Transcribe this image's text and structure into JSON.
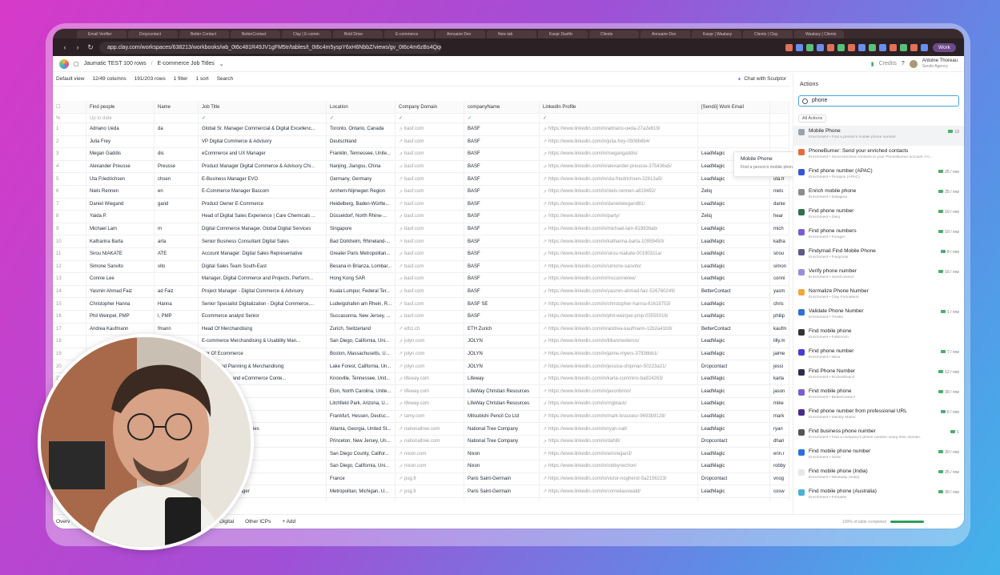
{
  "browser": {
    "url": "app.clay.com/workspaces/638213/workbooks/wb_0t6c481R49JV1gFM5tr/tables/t_0t6c4m5yspY6xH6NbbZ/views/gv_0t6c4m6zBs4Qq6w6z3y",
    "profile_label": "Work",
    "tabs": [
      "Email Verifier",
      "Dropcontact",
      "Better Contact",
      "BetterContact",
      "Clay | E-comm",
      "Bold Drive",
      "E-commerce",
      "Annuaire Dev",
      "New tab",
      "Kaspr Dashb",
      "Clients",
      "Annuaire Dev",
      "Kaspr | Waalaxy",
      "Clients | Clay",
      "Waalaxy | Clients"
    ]
  },
  "app": {
    "workspace": "Jaumatic TEST 100 rows",
    "view": "E-commerce Job Titles",
    "credits": "Credits",
    "user_name": "Antoine Thoreau",
    "user_org": "Sendo Agency"
  },
  "toolbar": {
    "view_btn": "Default view",
    "columns": "12/49 columns",
    "rows": "191/203 rows",
    "filter": "1 filter",
    "sort": "1 sort",
    "search": "Search",
    "chat": "Chat with Sculptor"
  },
  "columns": [
    "Find people",
    "Name",
    "Job Title",
    "Location",
    "Company Domain",
    "companyName",
    "LinkedIn Profile",
    "[Sendō] Work Email",
    ""
  ],
  "status_row": {
    "find": "Up to date",
    "check": "✓"
  },
  "rows": [
    [
      "1",
      "Adriano Ueda",
      "da",
      "Global Sr. Manager Commercial & Digital Excellenc...",
      "Toronto, Ontario, Canada",
      "basf.com",
      "BASF",
      "https://www.linkedin.com/in/adriano-ueda-27a2e619/",
      "",
      ""
    ],
    [
      "2",
      "Julia Frey",
      "",
      "VP Digital Commerce & Advisory",
      "Deutschland",
      "basf.com",
      "BASF",
      "https://www.linkedin.com/in/julia-frey-0506b8b4/",
      "",
      ""
    ],
    [
      "3",
      "Megan Gaddis",
      "dis",
      "eCommerce and UX Manager",
      "Franklin, Tennessee, Unite...",
      "basf.com",
      "BASF",
      "https://www.linkedin.com/in/megangaddis/",
      "LeadMagic",
      "mega"
    ],
    [
      "4",
      "Alexander Preusse",
      "Preusse",
      "Product Manager Digital Commerce & Advisory Chi...",
      "Nanjing, Jiangsu, China",
      "basf.com",
      "BASF",
      "https://www.linkedin.com/in/alexander-preusse-375436a5/",
      "LeadMagic",
      "alexa"
    ],
    [
      "5",
      "Uta Friedrichsen",
      "chsen",
      "E-Business Manager EVO",
      "Germany, Germany",
      "basf.com",
      "BASF",
      "https://www.linkedin.com/in/uta-friedrichsen-22813a5/",
      "LeadMagic",
      "uta.fr"
    ],
    [
      "6",
      "Niels Rennen",
      "en",
      "E-Commerce Manager Bascom",
      "Arnhem-Nijmegen Region",
      "basf.com",
      "BASF",
      "https://www.linkedin.com/in/niels-rennen-a819492/",
      "Zeliq",
      "niels"
    ],
    [
      "7",
      "Daniel Wiegand",
      "gand",
      "Product Owner E-Commerce",
      "Heidelberg, Baden-Württe...",
      "basf.com",
      "BASF",
      "https://www.linkedin.com/in/danielwiegand81/",
      "LeadMagic",
      "danie"
    ],
    [
      "8",
      "Yaida P.",
      "",
      "Head of Digital Sales Experience | Care Chemicals ...",
      "Düsseldorf, North Rhine-...",
      "basf.com",
      "BASF",
      "https://www.linkedin.com/in/party/",
      "Zeliq",
      "hear"
    ],
    [
      "9",
      "Michael Lam",
      "m",
      "Digital Commerce Manager, Global Digital Services",
      "Singapore",
      "basf.com",
      "BASF",
      "https://www.linkedin.com/in/michael-lam-819836ab/",
      "LeadMagic",
      "mich"
    ],
    [
      "10",
      "Katharina Barta",
      "arta",
      "Senior Business Consultant Digital Sales",
      "Bad Dürkheim, Rhineland-...",
      "basf.com",
      "BASF",
      "https://www.linkedin.com/in/katharina-barta-10959450/",
      "LeadMagic",
      "katha"
    ],
    [
      "11",
      "Sirou NIAKATE",
      "ATE",
      "Account Manager: Digital Sales Representative",
      "Greater Paris Metropolitan...",
      "basf.com",
      "BASF",
      "https://www.linkedin.com/in/sirou-niakate-00190311a/",
      "LeadMagic",
      "sirou"
    ],
    [
      "12",
      "Simone Sanvito",
      "vito",
      "Digital Sales Team South-East",
      "Besana in Brianza, Lombar...",
      "basf.com",
      "BASF",
      "https://www.linkedin.com/in/simone-sanvito/",
      "LeadMagic",
      "simon"
    ],
    [
      "13",
      "Connie Lee",
      "",
      "Manager, Digital Commerce and Projects, Perform...",
      "Hong Kong SAR",
      "basf.com",
      "BASF",
      "https://www.linkedin.com/in/msconnielee/",
      "LeadMagic",
      "conni"
    ],
    [
      "14",
      "Yasmin Ahmad Faiz",
      "ad Faiz",
      "Project Manager - Digital Commerce & Advisory",
      "Kuala Lumpur, Federal Ter...",
      "basf.com",
      "BASF",
      "https://www.linkedin.com/in/yasmin-ahmad-faiz-526760249/",
      "BetterContact",
      "yasm"
    ],
    [
      "15",
      "Christopher Hanna",
      "Hanna",
      "Senior Specialist Digitalization - Digital Commerce,...",
      "Ludwigshafen am Rhein, R...",
      "basf.com",
      "BASF SE",
      "https://www.linkedin.com/in/christopher-hanna-81618753/",
      "LeadMagic",
      "chris"
    ],
    [
      "16",
      "Phil Weinpel, PMP",
      "l, PMP",
      "Ecommerce analyst Senior",
      "Succasunna, New Jersey, ...",
      "basf.com",
      "BASF",
      "https://www.linkedin.com/in/phil-weinpel-pmp-03555016/",
      "LeadMagic",
      "philip"
    ],
    [
      "17",
      "Andrea Kaufmann",
      "fmann",
      "Head Of Merchandising",
      "Zurich, Switzerland",
      "ethz.ch",
      "ETH Zurich",
      "https://www.linkedin.com/in/andrea-kaufmann-12b2a41b9/",
      "BetterContact",
      "kaufm"
    ],
    [
      "18",
      "",
      "",
      "E-commerce Merchandising & Usability Man...",
      "San Diego, California, Uni...",
      "jolyn.com",
      "JOLYN",
      "https://www.linkedin.com/in/lillianmedeiros/",
      "LeadMagic",
      "lilly.m"
    ],
    [
      "19",
      "",
      "",
      "ctor Of Ecommerce",
      "Boston, Massachusetts, U...",
      "jolyn.com",
      "JOLYN",
      "https://www.linkedin.com/in/jaime-myers-37936bb1/",
      "LeadMagic",
      "jaime"
    ],
    [
      "20",
      "",
      "",
      "or, Demand Planning & Merchandising",
      "Lake Forest, California, Un...",
      "jolyn.com",
      "JOLYN",
      "https://www.linkedin.com/in/jessica-shipman-50223a21/",
      "Dropcontact",
      "jessi"
    ],
    [
      "21",
      "",
      "",
      "ting Strategist and eCommerce Conte...",
      "Knoxville, Tennessee, Unit...",
      "lifeway.com",
      "Lifeway",
      "https://www.linkedin.com/in/karla-cummins-ba924263/",
      "LeadMagic",
      "karla"
    ],
    [
      "22",
      "",
      "",
      "& eCommerce",
      "Elon, North Carolina, Unite...",
      "lifeway.com",
      "LifeWay Christian Resources",
      "https://www.linkedin.com/in/jasonbrinn/",
      "LeadMagic",
      "jason"
    ],
    [
      "23",
      "",
      "",
      "ating & E-Commerce",
      "Litchfield Park, Arizona, U...",
      "lifeway.com",
      "LifeWay Christian Resources",
      "https://www.linkedin.com/in/mgblack/",
      "LeadMagic",
      "mike"
    ],
    [
      "24",
      "",
      "",
      "",
      "Frankfurt, Hessen, Deutsc...",
      "lamy.com",
      "Mitsubishi Pencil Co Ltd",
      "https://www.linkedin.com/in/mark-brasseur-9693b9128/",
      "LeadMagic",
      "mark"
    ],
    [
      "25",
      "",
      "",
      "merce Sales & Capabilities",
      "Atlanta, Georgia, United St...",
      "nationaltree.com",
      "National Tree Company",
      "https://www.linkedin.com/in/ryan-nall/",
      "LeadMagic",
      "ryan"
    ],
    [
      "26",
      "",
      "",
      "t",
      "Princeton, New Jersey, Un...",
      "nationaltree.com",
      "National Tree Company",
      "https://www.linkedin.com/in/dahill/",
      "Dropcontact",
      "dhari"
    ],
    [
      "27",
      "",
      "",
      "ger",
      "San Diego County, Califor...",
      "nixon.com",
      "Nixon",
      "https://www.linkedin.com/in/erinregan3/",
      "LeadMagic",
      "erin.r"
    ],
    [
      "28",
      "",
      "",
      "ger",
      "San Diego, California, Uni...",
      "nixon.com",
      "Nixon",
      "https://www.linkedin.com/in/robbynechon/",
      "LeadMagic",
      "robby"
    ],
    [
      "29",
      "",
      "",
      "rce project manager",
      "France",
      "psg.fr",
      "Paris Saint-Germain",
      "https://www.linkedin.com/in/victor-nogherot-5a2156223/",
      "Dropcontact",
      "vnog"
    ],
    [
      "30",
      "",
      "",
      "ce & Product Manager",
      "Metropolitan, Michigan, U...",
      "psg.fr",
      "Paris Saint-Germain",
      "https://www.linkedin.com/in/corneliaoswald/",
      "LeadMagic",
      "cosw"
    ],
    [
      "31",
      "",
      "",
      "Ecommerce",
      "Greater Paris Metropolitan...",
      "psg.fr",
      "Paris Saint-Germain",
      "https://www.linkedin.com/in/aaliamani/",
      "LeadMagic",
      "aalia"
    ]
  ],
  "tooltip": {
    "title": "Mobile Phone",
    "desc": "Find a person's mobile phone number."
  },
  "actions_panel": {
    "title": "Actions",
    "search_value": "phone",
    "filter": "All Actions",
    "items": [
      {
        "title": "Mobile Phone",
        "sub": "Enrichment • Find a person's mobile phone number.",
        "cost": "13",
        "color": "#9aa3ad"
      },
      {
        "title": "PhoneBurner: Send your enriched contacts",
        "sub": "Enrichment • Send enriched contacts to your PhoneBurner account. Fo...",
        "cost": "",
        "color": "#e86a3c"
      },
      {
        "title": "Find phone number (APAC)",
        "sub": "Enrichment • Prospeo (APAC)",
        "cost": "25 / row",
        "color": "#3557d6"
      },
      {
        "title": "Enrich mobile phone",
        "sub": "Enrichment • Datagma",
        "cost": "25 / row",
        "color": "#8c8c8c"
      },
      {
        "title": "Find phone number",
        "sub": "Enrichment • Zeliq",
        "cost": "10 / row",
        "color": "#2f6f4e"
      },
      {
        "title": "Find phone numbers",
        "sub": "Enrichment • Forager",
        "cost": "10 / row",
        "color": "#7b5cd6"
      },
      {
        "title": "Findymail Find Mobile Phone",
        "sub": "Enrichment • Findymail",
        "cost": "8 / row",
        "color": "#5a5a8c"
      },
      {
        "title": "Verify phone number",
        "sub": "Enrichment • SureConnect",
        "cost": "16 / row",
        "color": "#9b8de0"
      },
      {
        "title": "Normalize Phone Number",
        "sub": "Enrichment • Clay Formatters",
        "cost": "",
        "color": "#f0a93c"
      },
      {
        "title": "Validate Phone Number",
        "sub": "Enrichment • Trestle",
        "cost": "1 / row",
        "color": "#2f6fd6"
      },
      {
        "title": "Find mobile phone",
        "sub": "Enrichment • FullEnrich",
        "cost": "",
        "color": "#333333"
      },
      {
        "title": "Find phone number",
        "sub": "Enrichment • Wiza",
        "cost": "7 / row",
        "color": "#4a3ad6"
      },
      {
        "title": "Find Phone Number",
        "sub": "Enrichment • RocketReach",
        "cost": "12 / row",
        "color": "#2c2c4a"
      },
      {
        "title": "Find mobile phone",
        "sub": "Enrichment • BetterContact",
        "cost": "30 / row",
        "color": "#7b5cd6"
      },
      {
        "title": "Find phone number from professional URL",
        "sub": "Enrichment • Identity Matrix",
        "cost": "6 / row",
        "color": "#4a2a8c"
      },
      {
        "title": "Find business phone number",
        "sub": "Enrichment • Find a company's phone number using their domain.",
        "cost": "1",
        "color": "#555555"
      },
      {
        "title": "Find mobile phone number",
        "sub": "Enrichment • Surfe",
        "cost": "20 / row",
        "color": "#2c6fe0"
      },
      {
        "title": "Find mobile phone (India)",
        "sub": "Enrichment • Weekday (India)",
        "cost": "25 / row",
        "color": "#e6e6e6"
      },
      {
        "title": "Find mobile phone (Australia)",
        "sub": "Enrichment • Firmable",
        "cost": "30 / row",
        "color": "#4ab0d6"
      }
    ]
  },
  "bottom_tabs": [
    "Overv",
    "nts for ICP 1 and...",
    "E-commerce Job Titles",
    "Head of Digital",
    "Other ICPs",
    "+ Add"
  ],
  "progress": {
    "label": "100% of table completed",
    "value": 1.0
  }
}
